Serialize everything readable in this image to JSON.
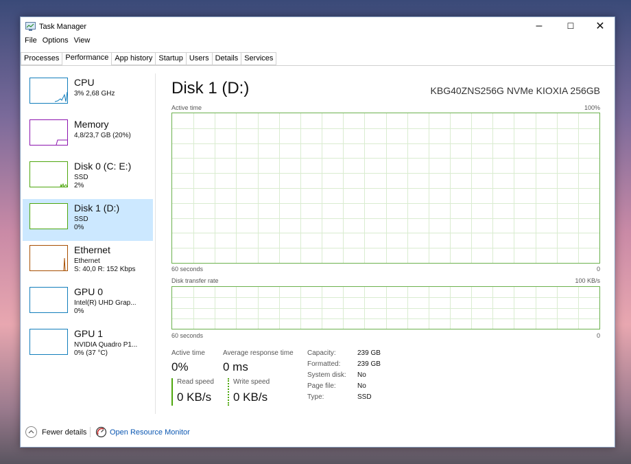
{
  "window": {
    "title": "Task Manager",
    "minimize": "–",
    "maximize": "☐",
    "close": "✕"
  },
  "menu": [
    "File",
    "Options",
    "View"
  ],
  "tabs": [
    "Processes",
    "Performance",
    "App history",
    "Startup",
    "Users",
    "Details",
    "Services"
  ],
  "sidebar": [
    {
      "name": "CPU",
      "sub1": "3% 2,68 GHz",
      "sub2": "",
      "sub3": "",
      "color": "#117dbb"
    },
    {
      "name": "Memory",
      "sub1": "4,8/23,7 GB (20%)",
      "sub2": "",
      "sub3": "",
      "color": "#8b12ae"
    },
    {
      "name": "Disk 0 (C: E:)",
      "sub1": "SSD",
      "sub2": "2%",
      "sub3": "",
      "color": "#4da60c"
    },
    {
      "name": "Disk 1 (D:)",
      "sub1": "SSD",
      "sub2": "0%",
      "sub3": "",
      "color": "#4da60c"
    },
    {
      "name": "Ethernet",
      "sub1": "Ethernet",
      "sub2": "S: 40,0 R: 152 Kbps",
      "sub3": "",
      "color": "#a74f01"
    },
    {
      "name": "GPU 0",
      "sub1": "Intel(R) UHD Grap...",
      "sub2": "0%",
      "sub3": "",
      "color": "#117dbb"
    },
    {
      "name": "GPU 1",
      "sub1": "NVIDIA Quadro P1...",
      "sub2": "0% (37 °C)",
      "sub3": "",
      "color": "#117dbb"
    }
  ],
  "main": {
    "title": "Disk 1 (D:)",
    "model": "KBG40ZNS256G NVMe KIOXIA 256GB",
    "graph1": {
      "label": "Active time",
      "max": "100%",
      "time": "60 seconds",
      "min": "0"
    },
    "graph2": {
      "label": "Disk transfer rate",
      "max": "100 KB/s",
      "time": "60 seconds",
      "min": "0"
    },
    "stats": {
      "active_time_label": "Active time",
      "active_time": "0%",
      "avg_resp_label": "Average response time",
      "avg_resp": "0 ms",
      "read_label": "Read speed",
      "read": "0 KB/s",
      "write_label": "Write speed",
      "write": "0 KB/s"
    },
    "props": [
      {
        "k": "Capacity:",
        "v": "239 GB"
      },
      {
        "k": "Formatted:",
        "v": "239 GB"
      },
      {
        "k": "System disk:",
        "v": "No"
      },
      {
        "k": "Page file:",
        "v": "No"
      },
      {
        "k": "Type:",
        "v": "SSD"
      }
    ]
  },
  "footer": {
    "fewer": "Fewer details",
    "resource_monitor": "Open Resource Monitor"
  }
}
